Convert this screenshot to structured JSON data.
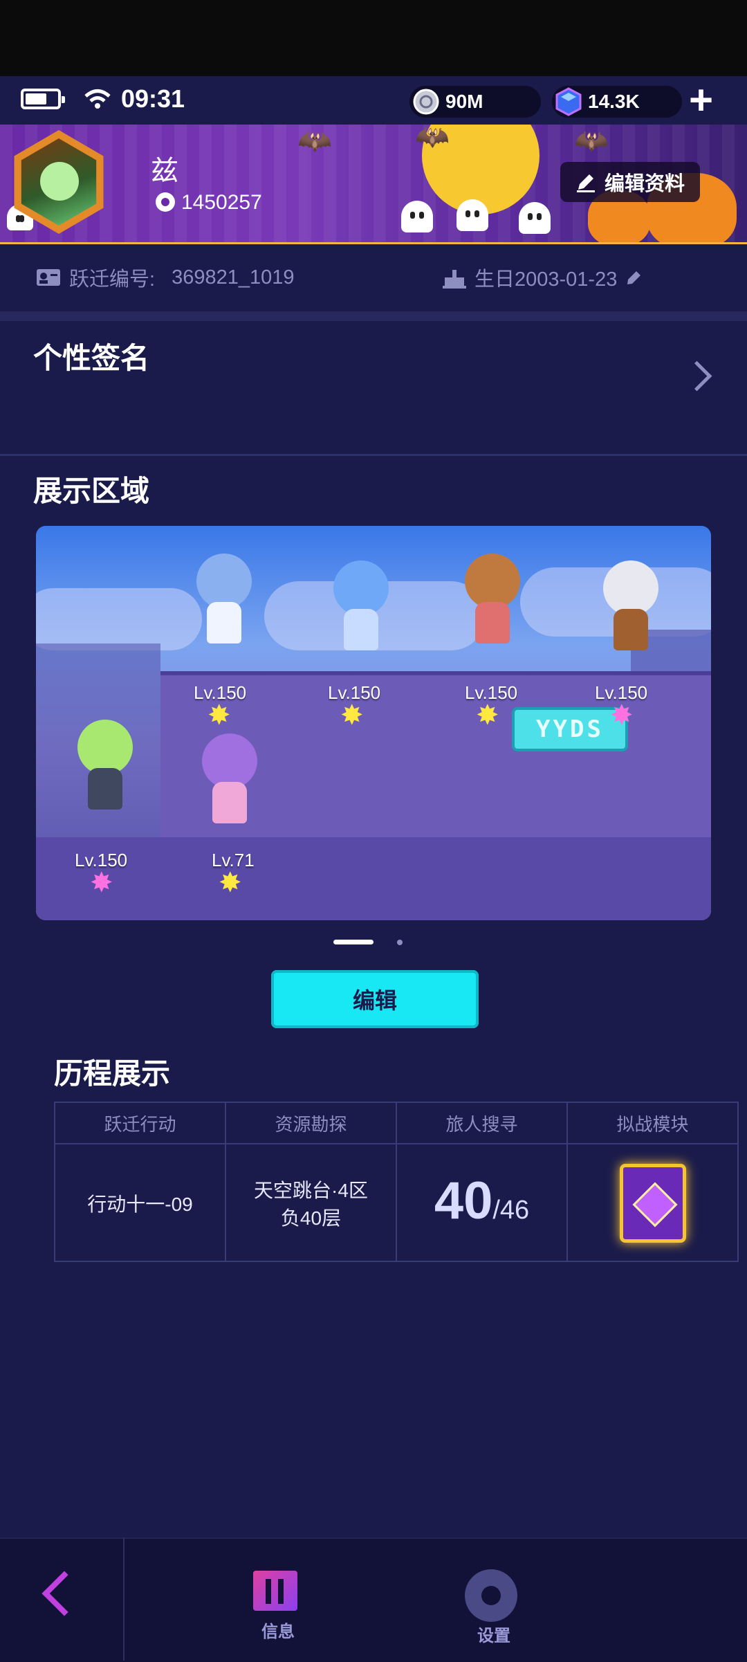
{
  "status_bar": {
    "time": "09:31",
    "coins": "90M",
    "gems": "14.3K",
    "add_label": "+"
  },
  "profile": {
    "name": "兹",
    "uid": "1450257",
    "edit_profile_label": "编辑资料",
    "jump_id_label": "跃迁编号:",
    "jump_id_value": "369821_1019",
    "birthday": "生日2003-01-23"
  },
  "signature": {
    "title": "个性签名"
  },
  "showcase": {
    "title": "展示区域",
    "sign_text": "YYDS",
    "characters": [
      {
        "level": "Lv.150"
      },
      {
        "level": "Lv.150"
      },
      {
        "level": "Lv.150"
      },
      {
        "level": "Lv.150"
      },
      {
        "level": "Lv.150"
      },
      {
        "level": "Lv.71"
      }
    ],
    "page_count": 2,
    "active_page": 1,
    "edit_label": "编辑"
  },
  "history": {
    "title": "历程展示",
    "headers": [
      "跃迁行动",
      "资源勘探",
      "旅人搜寻",
      "拟战模块"
    ],
    "jump_action": "行动十一-09",
    "resource_line1": "天空跳台·4区",
    "resource_line2": "负40层",
    "traveler_found": "40",
    "traveler_total": "/46"
  },
  "bottom_nav": {
    "info_label": "信息",
    "settings_label": "设置"
  },
  "colors": {
    "accent_cyan": "#17e8f4",
    "background": "#1b1b4b",
    "banner_gold": "#f2b640"
  }
}
